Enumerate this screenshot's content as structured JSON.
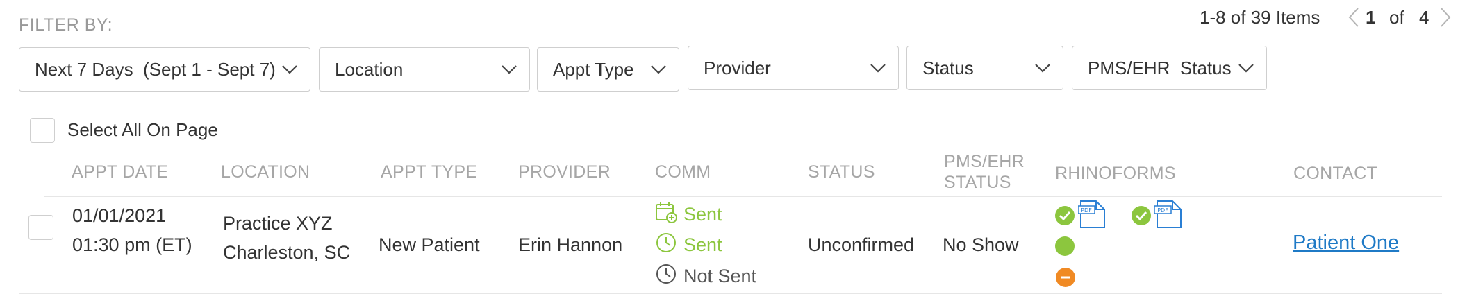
{
  "filter": {
    "label": "FILTER BY:",
    "dropdowns": [
      {
        "key": "date",
        "value": "Next 7 Days  (Sept 1 - Sept 7)"
      },
      {
        "key": "location",
        "value": "Location"
      },
      {
        "key": "appt_type",
        "value": "Appt Type"
      },
      {
        "key": "provider",
        "value": "Provider"
      },
      {
        "key": "status",
        "value": "Status"
      },
      {
        "key": "pms_ehr_status",
        "value": "PMS/EHR  Status"
      }
    ]
  },
  "pagination": {
    "range": "1-8 of 39 Items",
    "current_page": "1",
    "of_label": "of",
    "total_pages": "4"
  },
  "select_all": {
    "label": "Select All On Page"
  },
  "table": {
    "headers": {
      "appt_date": "APPT DATE",
      "location": "LOCATION",
      "appt_type": "APPT TYPE",
      "provider": "PROVIDER",
      "comm": "COMM",
      "status": "STATUS",
      "pms_ehr_line1": "PMS/EHR",
      "pms_ehr_line2": "STATUS",
      "rhinoforms": "RHINOFORMS",
      "contact": "CONTACT"
    },
    "rows": [
      {
        "date": "01/01/2021",
        "time": "01:30 pm (ET)",
        "location_name": "Practice XYZ",
        "location_city": "Charleston, SC",
        "appt_type": "New Patient",
        "provider": "Erin Hannon",
        "comm": [
          {
            "icon": "calendar-add-icon",
            "label": "Sent",
            "color": "#8cc63e"
          },
          {
            "icon": "clock-icon",
            "label": "Sent",
            "color": "#8cc63e"
          },
          {
            "icon": "clock-icon",
            "label": "Not Sent",
            "color": "#555555"
          }
        ],
        "status": "Unconfirmed",
        "pms_ehr_status": "No Show",
        "rhinoforms": {
          "form_icon_text": "PDF",
          "complete_color": "#8cc63e",
          "partial_color": "#f08a24"
        },
        "contact": "Patient One"
      }
    ]
  },
  "colors": {
    "accent_green": "#8cc63e",
    "accent_orange": "#f08a24",
    "link_blue": "#1f7ac6",
    "pdf_blue": "#2a7fd4"
  }
}
